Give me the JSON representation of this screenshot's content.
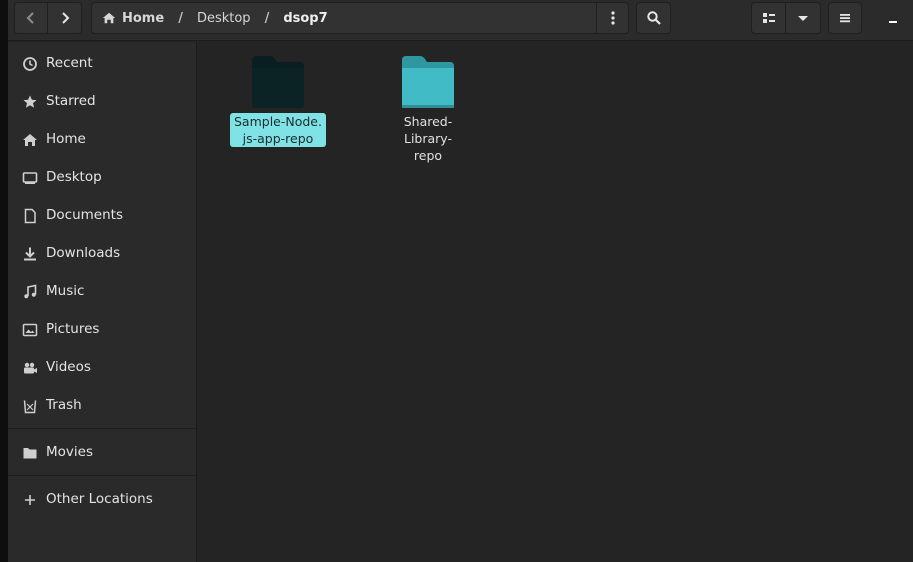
{
  "toolbar": {
    "breadcrumbs": [
      "Home",
      "Desktop",
      "dsop7"
    ],
    "separator": "/"
  },
  "sidebar": {
    "items": [
      {
        "label": "Recent",
        "icon": "clock-icon"
      },
      {
        "label": "Starred",
        "icon": "star-icon"
      },
      {
        "label": "Home",
        "icon": "home-icon"
      },
      {
        "label": "Desktop",
        "icon": "desktop-icon"
      },
      {
        "label": "Documents",
        "icon": "document-icon"
      },
      {
        "label": "Downloads",
        "icon": "download-icon"
      },
      {
        "label": "Music",
        "icon": "music-icon"
      },
      {
        "label": "Pictures",
        "icon": "picture-icon"
      },
      {
        "label": "Videos",
        "icon": "video-icon"
      },
      {
        "label": "Trash",
        "icon": "trash-icon"
      }
    ],
    "bookmarks": [
      {
        "label": "Movies",
        "icon": "folder-icon"
      }
    ],
    "other_locations": {
      "label": "Other Locations",
      "icon": "plus-icon"
    }
  },
  "files": [
    {
      "name": "Sample-Node.\njs-app-repo",
      "selected": true,
      "color": "#0c2326"
    },
    {
      "name": "Shared-Library-\nrepo",
      "selected": false,
      "color": "#41bcc6"
    }
  ],
  "colors": {
    "accent": "#7fe3e6",
    "folder": "#41bcc6",
    "folder_selected": "#0c2326"
  }
}
